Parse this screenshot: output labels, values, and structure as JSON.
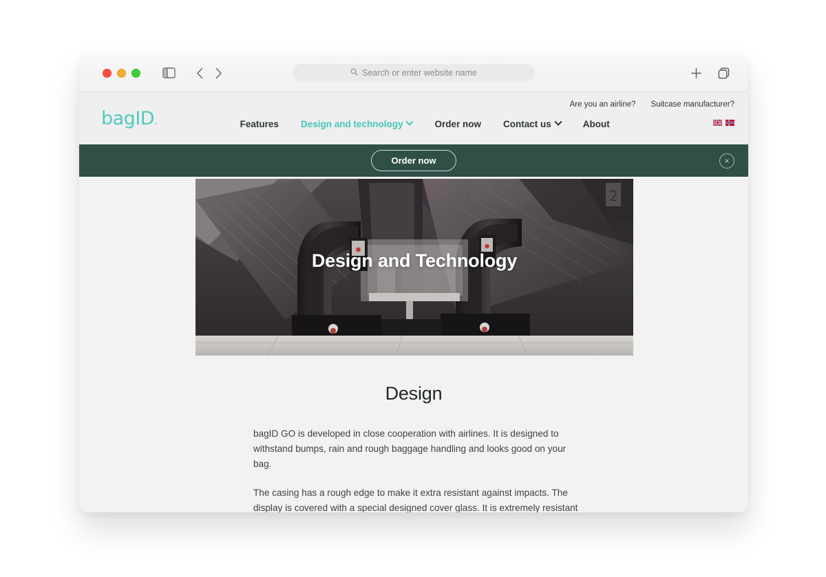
{
  "browser": {
    "traffic_lights": [
      "close",
      "minimize",
      "maximize"
    ],
    "sidebar_toggle": "sidebar-icon",
    "back_label": "‹",
    "forward_label": "›",
    "address_placeholder": "Search or enter website name",
    "search_icon": "search-icon",
    "new_tab_label": "+",
    "tab_overview_icon": "tabs-icon"
  },
  "site": {
    "logo_text": "bagID",
    "logo_mark": ".",
    "logo_color": "#52c9bd",
    "nav": [
      {
        "label": "Features",
        "active": false,
        "has_chevron": false
      },
      {
        "label": "Design and technology",
        "active": true,
        "has_chevron": true
      },
      {
        "label": "Order now",
        "active": false,
        "has_chevron": false
      },
      {
        "label": "Contact us",
        "active": false,
        "has_chevron": true
      },
      {
        "label": "About",
        "active": false,
        "has_chevron": false
      }
    ],
    "utility_links": [
      {
        "label": "Are you an airline?"
      },
      {
        "label": "Suitcase manufacturer?"
      }
    ],
    "flags": [
      {
        "name": "flag-uk"
      },
      {
        "name": "flag-denmark"
      }
    ]
  },
  "banner": {
    "button_label": "Order now",
    "close_label": "×",
    "background_color": "#2f4f47"
  },
  "hero": {
    "title": "Design and Technology",
    "image_alt": "escalators"
  },
  "main": {
    "section_title": "Design",
    "paragraphs": [
      "bagID GO is developed in close cooperation with airlines. It is designed to withstand bumps, rain and rough baggage handling and looks good on your bag.",
      "The casing has a rough edge to make it extra resistant against impacts. The display is covered with a special designed cover glass. It is extremely resistant to scratches and the gasket around it makes the device watertight."
    ]
  }
}
